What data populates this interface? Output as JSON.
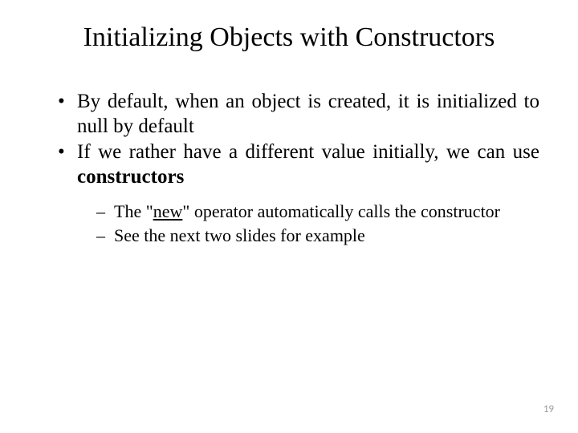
{
  "title": "Initializing Objects with Constructors",
  "bullets": {
    "b1": "By default, when an object is created, it is initialized to null by default",
    "b2_a": "If we rather have a different value initially, we can use ",
    "b2_b": "constructors"
  },
  "sub": {
    "s1_a": "The \"",
    "s1_b": "new",
    "s1_c": "\" operator automatically calls the constructor",
    "s2": "See the next two slides for example"
  },
  "page_number": "19"
}
